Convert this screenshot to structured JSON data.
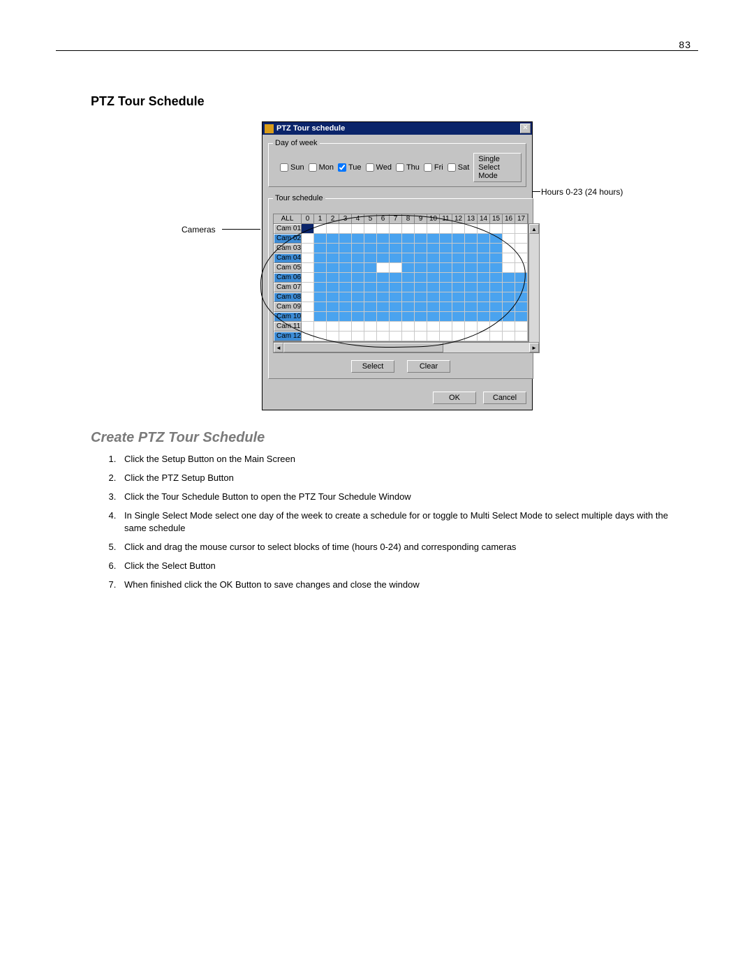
{
  "page_number": "83",
  "section_title": "PTZ Tour Schedule",
  "subsection_title": "Create PTZ Tour Schedule",
  "callouts": {
    "cameras": "Cameras",
    "hours": "Hours 0-23 (24 hours)"
  },
  "dialog": {
    "title": "PTZ Tour schedule",
    "close_label": "✕",
    "day_of_week_legend": "Day of week",
    "days": [
      {
        "label": "Sun",
        "checked": false
      },
      {
        "label": "Mon",
        "checked": false
      },
      {
        "label": "Tue",
        "checked": true
      },
      {
        "label": "Wed",
        "checked": false
      },
      {
        "label": "Thu",
        "checked": false
      },
      {
        "label": "Fri",
        "checked": false
      },
      {
        "label": "Sat",
        "checked": false
      }
    ],
    "mode_button": "Single Select Mode",
    "tour_schedule_legend": "Tour schedule",
    "header_all": "ALL",
    "hours_visible": [
      "0",
      "1",
      "2",
      "3",
      "4",
      "5",
      "6",
      "7",
      "8",
      "9",
      "10",
      "11",
      "12",
      "13",
      "14",
      "15",
      "16",
      "17"
    ],
    "cameras": [
      {
        "name": "Cam 01",
        "selected": false,
        "slots": [
          2,
          0,
          0,
          0,
          0,
          0,
          0,
          0,
          0,
          0,
          0,
          0,
          0,
          0,
          0,
          0,
          0,
          0
        ]
      },
      {
        "name": "Cam 02",
        "selected": true,
        "slots": [
          0,
          1,
          1,
          1,
          1,
          1,
          1,
          1,
          1,
          1,
          1,
          1,
          1,
          1,
          1,
          1,
          0,
          0
        ]
      },
      {
        "name": "Cam 03",
        "selected": false,
        "slots": [
          0,
          1,
          1,
          1,
          1,
          1,
          1,
          1,
          1,
          1,
          1,
          1,
          1,
          1,
          1,
          1,
          0,
          0
        ]
      },
      {
        "name": "Cam 04",
        "selected": true,
        "slots": [
          0,
          1,
          1,
          1,
          1,
          1,
          1,
          1,
          1,
          1,
          1,
          1,
          1,
          1,
          1,
          1,
          0,
          0
        ]
      },
      {
        "name": "Cam 05",
        "selected": false,
        "slots": [
          0,
          1,
          1,
          1,
          1,
          1,
          0,
          0,
          1,
          1,
          1,
          1,
          1,
          1,
          1,
          1,
          0,
          0
        ]
      },
      {
        "name": "Cam 06",
        "selected": true,
        "slots": [
          0,
          1,
          1,
          1,
          1,
          1,
          1,
          1,
          1,
          1,
          1,
          1,
          1,
          1,
          1,
          1,
          1,
          1
        ]
      },
      {
        "name": "Cam 07",
        "selected": false,
        "slots": [
          0,
          1,
          1,
          1,
          1,
          1,
          1,
          1,
          1,
          1,
          1,
          1,
          1,
          1,
          1,
          1,
          1,
          1
        ]
      },
      {
        "name": "Cam 08",
        "selected": true,
        "slots": [
          0,
          1,
          1,
          1,
          1,
          1,
          1,
          1,
          1,
          1,
          1,
          1,
          1,
          1,
          1,
          1,
          1,
          1
        ]
      },
      {
        "name": "Cam 09",
        "selected": false,
        "slots": [
          0,
          1,
          1,
          1,
          1,
          1,
          1,
          1,
          1,
          1,
          1,
          1,
          1,
          1,
          1,
          1,
          1,
          1
        ]
      },
      {
        "name": "Cam 10",
        "selected": true,
        "slots": [
          0,
          1,
          1,
          1,
          1,
          1,
          1,
          1,
          1,
          1,
          1,
          1,
          1,
          1,
          1,
          1,
          1,
          1
        ]
      },
      {
        "name": "Cam 11",
        "selected": false,
        "slots": [
          0,
          0,
          0,
          0,
          0,
          0,
          0,
          0,
          0,
          0,
          0,
          0,
          0,
          0,
          0,
          0,
          0,
          0
        ]
      },
      {
        "name": "Cam 12",
        "selected": true,
        "slots": [
          0,
          0,
          0,
          0,
          0,
          0,
          0,
          0,
          0,
          0,
          0,
          0,
          0,
          0,
          0,
          0,
          0,
          0
        ]
      }
    ],
    "select_button": "Select",
    "clear_button": "Clear",
    "ok_button": "OK",
    "cancel_button": "Cancel"
  },
  "steps": [
    "Click the Setup Button on the Main Screen",
    "Click the PTZ Setup Button",
    "Click the Tour Schedule Button to open the PTZ Tour Schedule Window",
    "In Single Select Mode select one day of the week to create a schedule for or toggle to Multi Select Mode to select multiple days with the same schedule",
    "Click and drag the mouse cursor to select blocks of time (hours 0-24) and corresponding cameras",
    "Click the Select Button",
    "When finished click the OK Button to save changes and close the window"
  ]
}
